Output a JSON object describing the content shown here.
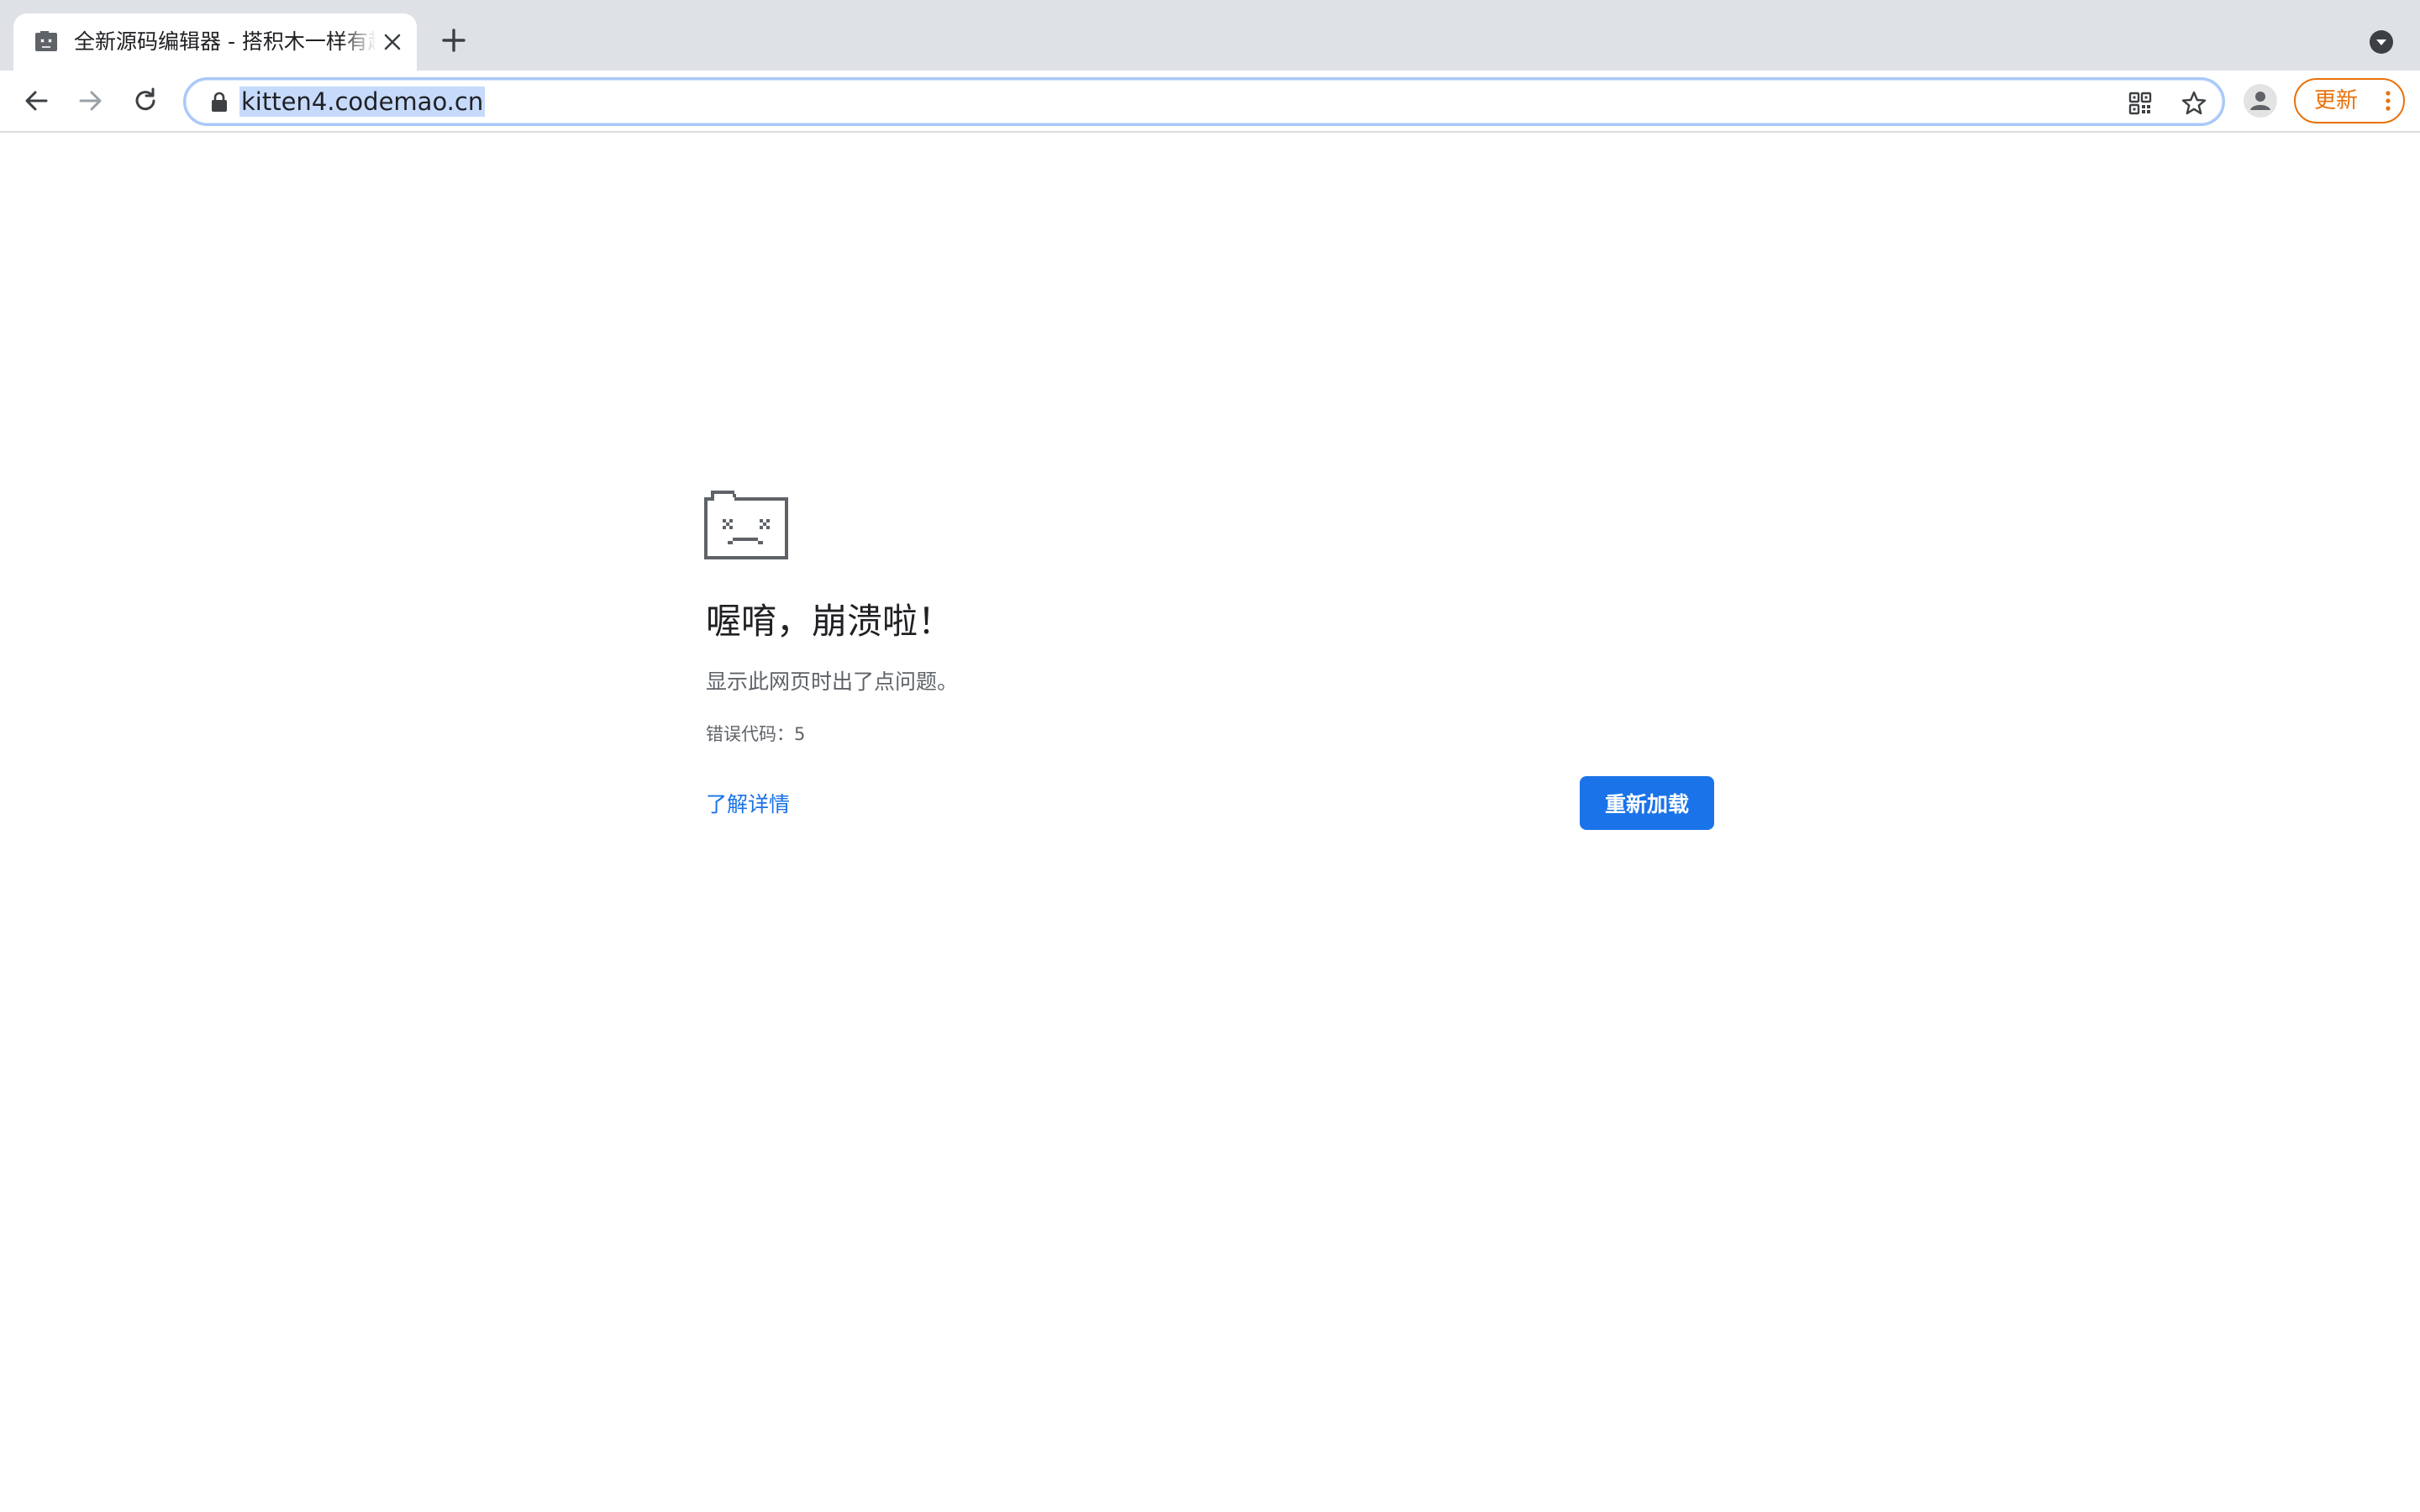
{
  "tab": {
    "title": "全新源码编辑器 - 搭积木一样有趣",
    "favicon": "sad-tab-icon",
    "close_icon": "close-icon"
  },
  "tabstrip": {
    "new_tab_icon": "plus-icon",
    "tab_search_icon": "chevron-down-circle-icon"
  },
  "toolbar": {
    "url": "kitten4.codemao.cn",
    "update_label": "更新",
    "icons": [
      "back-arrow-icon",
      "forward-arrow-icon",
      "reload-icon",
      "lock-icon",
      "qr-code-icon",
      "star-icon",
      "profile-icon",
      "more-vert-icon"
    ]
  },
  "crash": {
    "heading": "喔唷，崩溃啦！",
    "message": "显示此网页时出了点问题。",
    "error_code": "错误代码：5",
    "learn_more": "了解详情",
    "reload_label": "重新加载"
  },
  "colors": {
    "tabstrip_bg": "#dee1e6",
    "link_blue": "#1a73e8",
    "update_orange": "#e8710a",
    "url_selection": "#c6dafc"
  }
}
